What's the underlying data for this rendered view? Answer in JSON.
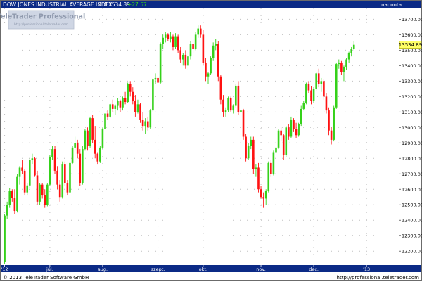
{
  "header": {
    "title": "DOW JONES INDUSTRIAL AVERAGE INDEX",
    "close_label": "C: 13534.89",
    "change_label": "+27.57",
    "period": "naponta"
  },
  "watermark": {
    "brand": "TeleTrader Professional",
    "url": "http://professional.teletrader.com"
  },
  "footer": {
    "copyright": "© 2013 TeleTrader Software GmbH",
    "url": "http://professional.teletrader.com"
  },
  "colors": {
    "background": "#ffffff",
    "header_bg": "#0b2a86",
    "up_candle": "#35d11a",
    "down_candle": "#ff1111",
    "price_tag": "#ffff66",
    "grid_dots": "#c0c0c0"
  },
  "chart_data": {
    "type": "candlestick",
    "title": "DOW JONES INDUSTRIAL AVERAGE INDEX",
    "frequency": "naponta",
    "last_close": 13534.89,
    "last_close_label": "13534.89",
    "change": 27.57,
    "ylim": [
      12110,
      13770
    ],
    "yticks": [
      12200,
      12300,
      12400,
      12500,
      12600,
      12700,
      12800,
      12900,
      13000,
      13100,
      13200,
      13300,
      13400,
      13500,
      13600,
      13700
    ],
    "ytick_labels": [
      "12200.00",
      "12300.00",
      "12400.00",
      "12500.00",
      "12600.00",
      "12700.00",
      "12800.00",
      "12900.00",
      "13000.00",
      "13100.00",
      "13200.00",
      "13300.00",
      "13400.00",
      "13500.00",
      "13600.00",
      "13700.00"
    ],
    "xlim": [
      0,
      157
    ],
    "xticks": [
      {
        "label": "'12",
        "x": 1
      },
      {
        "label": "júl.",
        "x": 19
      },
      {
        "label": "aug.",
        "x": 40
      },
      {
        "label": "szept.",
        "x": 62
      },
      {
        "label": "okt.",
        "x": 80
      },
      {
        "label": "nov.",
        "x": 103
      },
      {
        "label": "dec.",
        "x": 124
      },
      {
        "label": "'13",
        "x": 145
      }
    ],
    "grid": true,
    "candles": [
      {
        "t": 1,
        "o": 12131,
        "h": 12440,
        "l": 12118,
        "c": 12430
      },
      {
        "t": 2,
        "o": 12430,
        "h": 12520,
        "l": 12410,
        "c": 12500
      },
      {
        "t": 3,
        "o": 12500,
        "h": 12610,
        "l": 12480,
        "c": 12590
      },
      {
        "t": 4,
        "o": 12590,
        "h": 12600,
        "l": 12520,
        "c": 12545
      },
      {
        "t": 5,
        "o": 12545,
        "h": 12600,
        "l": 12440,
        "c": 12460
      },
      {
        "t": 6,
        "o": 12460,
        "h": 12700,
        "l": 12450,
        "c": 12680
      },
      {
        "t": 7,
        "o": 12680,
        "h": 12750,
        "l": 12630,
        "c": 12740
      },
      {
        "t": 8,
        "o": 12740,
        "h": 12790,
        "l": 12700,
        "c": 12720
      },
      {
        "t": 9,
        "o": 12720,
        "h": 12730,
        "l": 12560,
        "c": 12580
      },
      {
        "t": 10,
        "o": 12580,
        "h": 12640,
        "l": 12560,
        "c": 12625
      },
      {
        "t": 11,
        "o": 12625,
        "h": 12800,
        "l": 12610,
        "c": 12790
      },
      {
        "t": 12,
        "o": 12790,
        "h": 12830,
        "l": 12760,
        "c": 12800
      },
      {
        "t": 13,
        "o": 12800,
        "h": 12810,
        "l": 12680,
        "c": 12690
      },
      {
        "t": 14,
        "o": 12690,
        "h": 12720,
        "l": 12500,
        "c": 12520
      },
      {
        "t": 15,
        "o": 12520,
        "h": 12640,
        "l": 12500,
        "c": 12630
      },
      {
        "t": 16,
        "o": 12630,
        "h": 12640,
        "l": 12540,
        "c": 12560
      },
      {
        "t": 17,
        "o": 12560,
        "h": 12600,
        "l": 12480,
        "c": 12500
      },
      {
        "t": 18,
        "o": 12500,
        "h": 12640,
        "l": 12490,
        "c": 12630
      },
      {
        "t": 19,
        "o": 12630,
        "h": 12820,
        "l": 12620,
        "c": 12810
      },
      {
        "t": 20,
        "o": 12810,
        "h": 12880,
        "l": 12790,
        "c": 12860
      },
      {
        "t": 21,
        "o": 12860,
        "h": 12880,
        "l": 12700,
        "c": 12720
      },
      {
        "t": 22,
        "o": 12720,
        "h": 12750,
        "l": 12600,
        "c": 12630
      },
      {
        "t": 23,
        "o": 12630,
        "h": 12660,
        "l": 12520,
        "c": 12550
      },
      {
        "t": 24,
        "o": 12550,
        "h": 12780,
        "l": 12540,
        "c": 12760
      },
      {
        "t": 25,
        "o": 12760,
        "h": 12780,
        "l": 12620,
        "c": 12640
      },
      {
        "t": 26,
        "o": 12640,
        "h": 12660,
        "l": 12560,
        "c": 12580
      },
      {
        "t": 27,
        "o": 12580,
        "h": 12780,
        "l": 12570,
        "c": 12770
      },
      {
        "t": 28,
        "o": 12770,
        "h": 12880,
        "l": 12760,
        "c": 12870
      },
      {
        "t": 29,
        "o": 12870,
        "h": 12940,
        "l": 12850,
        "c": 12900
      },
      {
        "t": 30,
        "o": 12900,
        "h": 12920,
        "l": 12800,
        "c": 12830
      },
      {
        "t": 31,
        "o": 12830,
        "h": 12860,
        "l": 12620,
        "c": 12640
      },
      {
        "t": 32,
        "o": 12640,
        "h": 12880,
        "l": 12630,
        "c": 12860
      },
      {
        "t": 33,
        "o": 12860,
        "h": 12990,
        "l": 12850,
        "c": 12980
      },
      {
        "t": 34,
        "o": 12980,
        "h": 13000,
        "l": 12850,
        "c": 12880
      },
      {
        "t": 35,
        "o": 12880,
        "h": 13070,
        "l": 12870,
        "c": 13060
      },
      {
        "t": 36,
        "o": 13060,
        "h": 13080,
        "l": 12900,
        "c": 12920
      },
      {
        "t": 37,
        "o": 12920,
        "h": 13010,
        "l": 12800,
        "c": 12830
      },
      {
        "t": 38,
        "o": 12830,
        "h": 12840,
        "l": 12760,
        "c": 12780
      },
      {
        "t": 39,
        "o": 12780,
        "h": 12880,
        "l": 12770,
        "c": 12870
      },
      {
        "t": 40,
        "o": 12870,
        "h": 13000,
        "l": 12860,
        "c": 12990
      },
      {
        "t": 41,
        "o": 12990,
        "h": 13100,
        "l": 12980,
        "c": 13090
      },
      {
        "t": 42,
        "o": 13090,
        "h": 13110,
        "l": 13050,
        "c": 13070
      },
      {
        "t": 43,
        "o": 13070,
        "h": 13160,
        "l": 13060,
        "c": 13150
      },
      {
        "t": 44,
        "o": 13150,
        "h": 13180,
        "l": 13100,
        "c": 13120
      },
      {
        "t": 45,
        "o": 13120,
        "h": 13150,
        "l": 13080,
        "c": 13140
      },
      {
        "t": 46,
        "o": 13140,
        "h": 13190,
        "l": 13110,
        "c": 13170
      },
      {
        "t": 47,
        "o": 13170,
        "h": 13180,
        "l": 13100,
        "c": 13130
      },
      {
        "t": 48,
        "o": 13130,
        "h": 13200,
        "l": 13110,
        "c": 13190
      },
      {
        "t": 49,
        "o": 13190,
        "h": 13230,
        "l": 13150,
        "c": 13165
      },
      {
        "t": 50,
        "o": 13165,
        "h": 13290,
        "l": 13160,
        "c": 13280
      },
      {
        "t": 51,
        "o": 13280,
        "h": 13300,
        "l": 13200,
        "c": 13230
      },
      {
        "t": 52,
        "o": 13230,
        "h": 13260,
        "l": 13150,
        "c": 13170
      },
      {
        "t": 53,
        "o": 13170,
        "h": 13210,
        "l": 13070,
        "c": 13100
      },
      {
        "t": 54,
        "o": 13100,
        "h": 13180,
        "l": 13090,
        "c": 13150
      },
      {
        "t": 55,
        "o": 13150,
        "h": 13160,
        "l": 13030,
        "c": 13050
      },
      {
        "t": 56,
        "o": 13050,
        "h": 13100,
        "l": 12980,
        "c": 13010
      },
      {
        "t": 57,
        "o": 13010,
        "h": 13060,
        "l": 12960,
        "c": 13040
      },
      {
        "t": 58,
        "o": 13040,
        "h": 13070,
        "l": 12980,
        "c": 13000
      },
      {
        "t": 59,
        "o": 13000,
        "h": 13120,
        "l": 12990,
        "c": 13110
      },
      {
        "t": 60,
        "o": 13110,
        "h": 13320,
        "l": 13100,
        "c": 13310
      },
      {
        "t": 61,
        "o": 13310,
        "h": 13350,
        "l": 13280,
        "c": 13320
      },
      {
        "t": 62,
        "o": 13320,
        "h": 13330,
        "l": 13260,
        "c": 13290
      },
      {
        "t": 63,
        "o": 13290,
        "h": 13550,
        "l": 13280,
        "c": 13540
      },
      {
        "t": 64,
        "o": 13540,
        "h": 13600,
        "l": 13510,
        "c": 13580
      },
      {
        "t": 65,
        "o": 13580,
        "h": 13620,
        "l": 13550,
        "c": 13600
      },
      {
        "t": 66,
        "o": 13600,
        "h": 13610,
        "l": 13560,
        "c": 13570
      },
      {
        "t": 67,
        "o": 13570,
        "h": 13620,
        "l": 13550,
        "c": 13590
      },
      {
        "t": 68,
        "o": 13590,
        "h": 13600,
        "l": 13500,
        "c": 13520
      },
      {
        "t": 69,
        "o": 13520,
        "h": 13610,
        "l": 13510,
        "c": 13590
      },
      {
        "t": 70,
        "o": 13590,
        "h": 13600,
        "l": 13480,
        "c": 13500
      },
      {
        "t": 71,
        "o": 13500,
        "h": 13520,
        "l": 13420,
        "c": 13440
      },
      {
        "t": 72,
        "o": 13440,
        "h": 13480,
        "l": 13400,
        "c": 13470
      },
      {
        "t": 73,
        "o": 13470,
        "h": 13500,
        "l": 13380,
        "c": 13400
      },
      {
        "t": 74,
        "o": 13400,
        "h": 13480,
        "l": 13370,
        "c": 13460
      },
      {
        "t": 75,
        "o": 13460,
        "h": 13560,
        "l": 13440,
        "c": 13540
      },
      {
        "t": 76,
        "o": 13540,
        "h": 13570,
        "l": 13480,
        "c": 13510
      },
      {
        "t": 77,
        "o": 13510,
        "h": 13620,
        "l": 13500,
        "c": 13600
      },
      {
        "t": 78,
        "o": 13600,
        "h": 13660,
        "l": 13580,
        "c": 13640
      },
      {
        "t": 79,
        "o": 13640,
        "h": 13660,
        "l": 13580,
        "c": 13600
      },
      {
        "t": 80,
        "o": 13600,
        "h": 13630,
        "l": 13400,
        "c": 13420
      },
      {
        "t": 81,
        "o": 13420,
        "h": 13450,
        "l": 13300,
        "c": 13330
      },
      {
        "t": 82,
        "o": 13330,
        "h": 13360,
        "l": 13280,
        "c": 13350
      },
      {
        "t": 83,
        "o": 13350,
        "h": 13460,
        "l": 13340,
        "c": 13450
      },
      {
        "t": 84,
        "o": 13450,
        "h": 13550,
        "l": 13430,
        "c": 13530
      },
      {
        "t": 85,
        "o": 13530,
        "h": 13570,
        "l": 13500,
        "c": 13540
      },
      {
        "t": 86,
        "o": 13540,
        "h": 13560,
        "l": 13300,
        "c": 13330
      },
      {
        "t": 87,
        "o": 13330,
        "h": 13340,
        "l": 13150,
        "c": 13180
      },
      {
        "t": 88,
        "o": 13180,
        "h": 13210,
        "l": 13070,
        "c": 13100
      },
      {
        "t": 89,
        "o": 13100,
        "h": 13130,
        "l": 13070,
        "c": 13110
      },
      {
        "t": 90,
        "o": 13110,
        "h": 13200,
        "l": 13100,
        "c": 13190
      },
      {
        "t": 91,
        "o": 13190,
        "h": 13200,
        "l": 13100,
        "c": 13110
      },
      {
        "t": 92,
        "o": 13110,
        "h": 13150,
        "l": 13090,
        "c": 13140
      },
      {
        "t": 93,
        "o": 13140,
        "h": 13280,
        "l": 13130,
        "c": 13270
      },
      {
        "t": 94,
        "o": 13270,
        "h": 13300,
        "l": 13080,
        "c": 13100
      },
      {
        "t": 95,
        "o": 13100,
        "h": 13130,
        "l": 13050,
        "c": 13110
      },
      {
        "t": 96,
        "o": 13110,
        "h": 13120,
        "l": 12920,
        "c": 12940
      },
      {
        "t": 97,
        "o": 12940,
        "h": 12960,
        "l": 12780,
        "c": 12800
      },
      {
        "t": 98,
        "o": 12800,
        "h": 12900,
        "l": 12790,
        "c": 12880
      },
      {
        "t": 99,
        "o": 12880,
        "h": 12940,
        "l": 12860,
        "c": 12920
      },
      {
        "t": 100,
        "o": 12920,
        "h": 12940,
        "l": 12700,
        "c": 12730
      },
      {
        "t": 101,
        "o": 12730,
        "h": 12760,
        "l": 12680,
        "c": 12740
      },
      {
        "t": 102,
        "o": 12740,
        "h": 12770,
        "l": 12580,
        "c": 12600
      },
      {
        "t": 103,
        "o": 12600,
        "h": 12620,
        "l": 12540,
        "c": 12550
      },
      {
        "t": 104,
        "o": 12550,
        "h": 12580,
        "l": 12480,
        "c": 12540
      },
      {
        "t": 105,
        "o": 12540,
        "h": 12600,
        "l": 12500,
        "c": 12590
      },
      {
        "t": 106,
        "o": 12590,
        "h": 12780,
        "l": 12580,
        "c": 12770
      },
      {
        "t": 107,
        "o": 12770,
        "h": 12790,
        "l": 12680,
        "c": 12700
      },
      {
        "t": 108,
        "o": 12700,
        "h": 12850,
        "l": 12690,
        "c": 12840
      },
      {
        "t": 109,
        "o": 12840,
        "h": 12900,
        "l": 12780,
        "c": 12870
      },
      {
        "t": 110,
        "o": 12870,
        "h": 12990,
        "l": 12860,
        "c": 12980
      },
      {
        "t": 111,
        "o": 12980,
        "h": 13000,
        "l": 12910,
        "c": 12950
      },
      {
        "t": 112,
        "o": 12950,
        "h": 12960,
        "l": 12790,
        "c": 12820
      },
      {
        "t": 113,
        "o": 12820,
        "h": 13010,
        "l": 12810,
        "c": 13000
      },
      {
        "t": 114,
        "o": 13000,
        "h": 13020,
        "l": 12920,
        "c": 12940
      },
      {
        "t": 115,
        "o": 12940,
        "h": 13070,
        "l": 12930,
        "c": 13050
      },
      {
        "t": 116,
        "o": 13050,
        "h": 13060,
        "l": 12970,
        "c": 12990
      },
      {
        "t": 117,
        "o": 12990,
        "h": 13030,
        "l": 12930,
        "c": 12950
      },
      {
        "t": 118,
        "o": 12950,
        "h": 13030,
        "l": 12940,
        "c": 13020
      },
      {
        "t": 119,
        "o": 13020,
        "h": 13140,
        "l": 13010,
        "c": 13120
      },
      {
        "t": 120,
        "o": 13120,
        "h": 13170,
        "l": 13110,
        "c": 13160
      },
      {
        "t": 121,
        "o": 13160,
        "h": 13290,
        "l": 13150,
        "c": 13280
      },
      {
        "t": 122,
        "o": 13280,
        "h": 13300,
        "l": 13220,
        "c": 13240
      },
      {
        "t": 123,
        "o": 13240,
        "h": 13270,
        "l": 13150,
        "c": 13170
      },
      {
        "t": 124,
        "o": 13170,
        "h": 13260,
        "l": 13160,
        "c": 13250
      },
      {
        "t": 125,
        "o": 13250,
        "h": 13360,
        "l": 13240,
        "c": 13350
      },
      {
        "t": 126,
        "o": 13350,
        "h": 13380,
        "l": 13260,
        "c": 13280
      },
      {
        "t": 127,
        "o": 13280,
        "h": 13320,
        "l": 13230,
        "c": 13300
      },
      {
        "t": 128,
        "o": 13300,
        "h": 13310,
        "l": 13180,
        "c": 13200
      },
      {
        "t": 129,
        "o": 13200,
        "h": 13220,
        "l": 13090,
        "c": 13110
      },
      {
        "t": 130,
        "o": 13110,
        "h": 13130,
        "l": 12950,
        "c": 12980
      },
      {
        "t": 131,
        "o": 12980,
        "h": 13000,
        "l": 12890,
        "c": 12920
      },
      {
        "t": 132,
        "o": 12920,
        "h": 13140,
        "l": 12910,
        "c": 13130
      },
      {
        "t": 133,
        "o": 13130,
        "h": 13420,
        "l": 13120,
        "c": 13410
      },
      {
        "t": 134,
        "o": 13410,
        "h": 13440,
        "l": 13380,
        "c": 13420
      },
      {
        "t": 135,
        "o": 13420,
        "h": 13430,
        "l": 13340,
        "c": 13360
      },
      {
        "t": 136,
        "o": 13360,
        "h": 13400,
        "l": 13300,
        "c": 13390
      },
      {
        "t": 137,
        "o": 13390,
        "h": 13450,
        "l": 13370,
        "c": 13440
      },
      {
        "t": 138,
        "o": 13440,
        "h": 13490,
        "l": 13420,
        "c": 13480
      },
      {
        "t": 139,
        "o": 13480,
        "h": 13520,
        "l": 13460,
        "c": 13507
      },
      {
        "t": 140,
        "o": 13507,
        "h": 13560,
        "l": 13500,
        "c": 13534.89
      }
    ]
  }
}
